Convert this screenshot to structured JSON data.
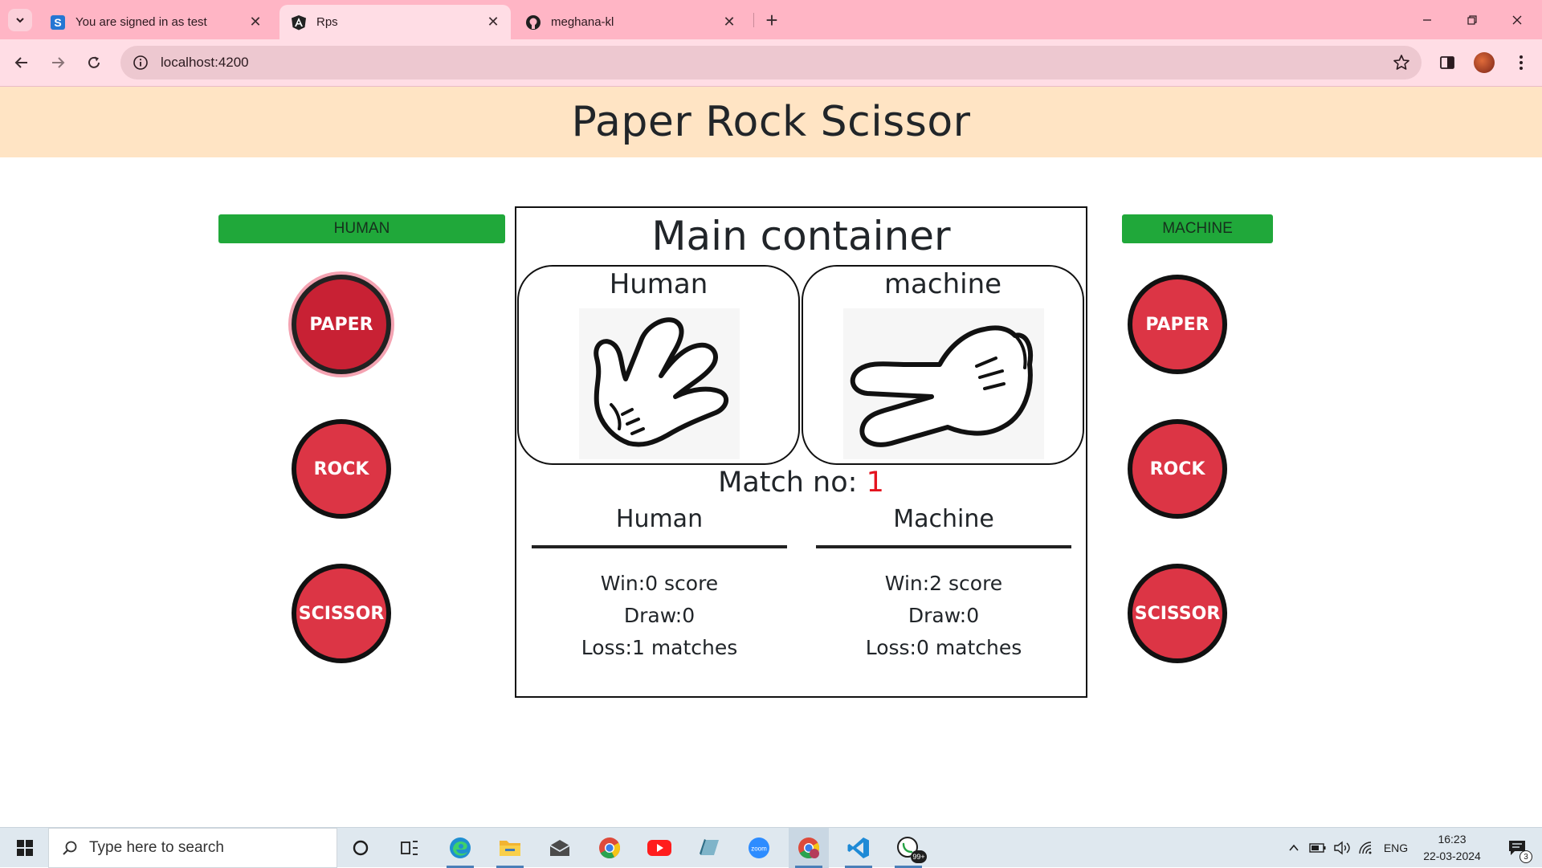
{
  "browser": {
    "tabs": [
      {
        "title": "You are signed in as test",
        "active": false,
        "favicon": "s-letter-icon"
      },
      {
        "title": "Rps",
        "active": true,
        "favicon": "angular-icon"
      },
      {
        "title": "meghana-kl",
        "active": false,
        "favicon": "github-icon"
      }
    ],
    "close_glyph": "✕",
    "new_tab_glyph": "+",
    "url": "localhost:4200",
    "theme_color": "#ffb5c5"
  },
  "page": {
    "title": "Paper Rock Scissor",
    "human_label": "HUMAN",
    "machine_label": "MACHINE",
    "human_choices": [
      "PAPER",
      "ROCK",
      "SCISSOR"
    ],
    "machine_choices": [
      "PAPER",
      "ROCK",
      "SCISSOR"
    ],
    "selected_human_choice": "PAPER",
    "main_container_title": "Main container",
    "human_card_name": "Human",
    "machine_card_name": "machine",
    "human_hand_icon": "scissors-hand-icon",
    "machine_hand_icon": "scissors-hand-icon",
    "match_no_label": "Match no: ",
    "match_no": "1",
    "scores": {
      "human": {
        "heading": "Human",
        "win": "Win:0 score",
        "draw": "Draw:0",
        "loss": "Loss:1 matches"
      },
      "machine": {
        "heading": "Machine",
        "win": "Win:2 score",
        "draw": "Draw:0",
        "loss": "Loss:0 matches"
      }
    },
    "colors": {
      "header_bg": "#ffe4c4",
      "label_green": "#20a83a",
      "choice_red": "#dc3545",
      "match_red": "#e4141f"
    }
  },
  "taskbar": {
    "search_placeholder": "Type here to search",
    "apps": [
      "cortana-icon",
      "task-view-icon",
      "edge-icon",
      "file-explorer-icon",
      "mail-icon",
      "chrome-icon",
      "youtube-icon",
      "app-icon",
      "zoom-icon",
      "chrome-profile-icon",
      "vscode-icon",
      "whatsapp-icon"
    ],
    "whatsapp_badge": "99+",
    "language": "ENG",
    "time": "16:23",
    "date": "22-03-2024",
    "notification_count": "3"
  }
}
